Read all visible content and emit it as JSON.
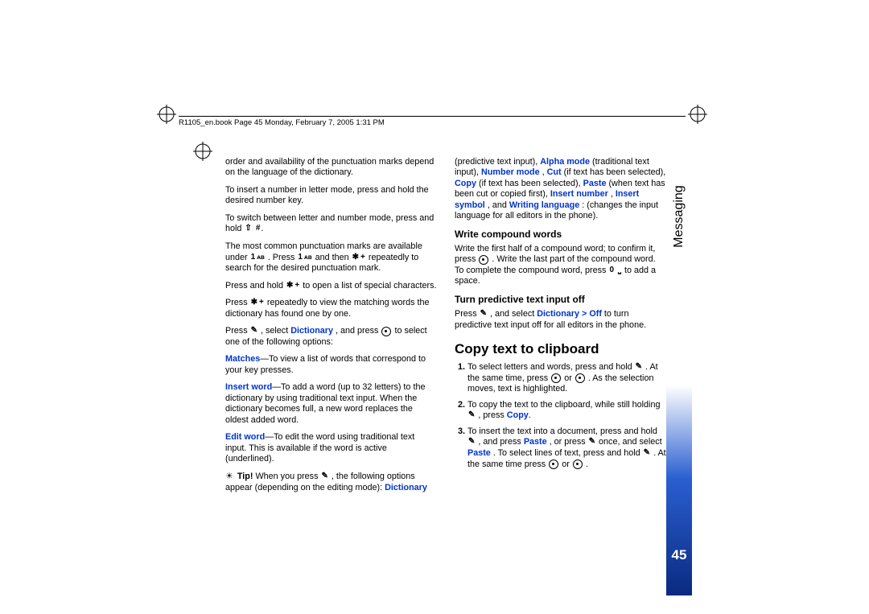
{
  "header": {
    "crop_info": "R1105_en.book  Page 45  Monday, February 7, 2005  1:31 PM"
  },
  "side": {
    "section": "Messaging",
    "page": "45"
  },
  "left_col": {
    "p1": "order and availability of the punctuation marks depend on the language of the dictionary.",
    "p2": "To insert a number in letter mode, press and hold the desired number key.",
    "p3": "To switch between letter and number mode, press and hold ",
    "p4a": "The most common punctuation marks are available under ",
    "p4b": ". Press ",
    "p4c": " and then ",
    "p4d": " repeatedly to search for the desired punctuation mark.",
    "p5a": "Press and hold ",
    "p5b": " to open a list of special characters.",
    "p6a": "Press ",
    "p6b": " repeatedly to view the matching words the dictionary has found one by one.",
    "p7a": "Press ",
    "p7b": ", select ",
    "p7c": "Dictionary",
    "p7d": ", and press ",
    "p7e": " to select one of the following options:",
    "p8a": "Matches",
    "p8b": "—To view a list of words that correspond to your key presses.",
    "p9a": "Insert word",
    "p9b": "—To add a word (up to 32 letters) to the dictionary by using traditional text input. When the dictionary becomes full, a new word replaces the oldest added word.",
    "p10a": "Edit word",
    "p10b": "—To edit the word using traditional text input. This is available if the word is active (underlined).",
    "tip_label": "Tip!",
    "tip_a": " When you press ",
    "tip_b": ", the following options appear (depending on the editing mode): ",
    "tip_c": "Dictionary"
  },
  "right_col": {
    "p1a": "(predictive text input), ",
    "p1b": "Alpha mode",
    "p1c": " (traditional text input), ",
    "p1d": "Number mode",
    "p1e": ", ",
    "p1f": "Cut",
    "p1g": " (if text has been selected), ",
    "p1h": "Copy",
    "p1i": " (if text has been selected), ",
    "p1j": "Paste",
    "p1k": " (when text has been cut or copied first), ",
    "p1l": "Insert number",
    "p1m": ", ",
    "p1n": "Insert symbol",
    "p1o": ", and ",
    "p1p": "Writing language",
    "p1q": ": (changes the input language for all editors in the phone).",
    "h_compound": "Write compound words",
    "p2a": "Write the first half of a compound word; to confirm it, press ",
    "p2b": ". Write the last part of the compound word. To complete the compound word, press ",
    "p2c": " to add a space.",
    "h_turnoff": "Turn predictive text input off",
    "p3a": "Press ",
    "p3b": ", and select ",
    "p3c": "Dictionary > Off",
    "p3d": " to turn predictive text input off for all editors in the phone.",
    "h_copy": "Copy text to clipboard",
    "s1a": "To select letters and words, press and hold ",
    "s1b": ". At the same time, press ",
    "s1c": " or ",
    "s1d": ". As the selection moves, text is highlighted.",
    "s2a": "To copy the text to the clipboard, while still holding ",
    "s2b": ", press ",
    "s2c": "Copy",
    "s2d": ".",
    "s3a": "To insert the text into a document, press and hold ",
    "s3b": ", and press ",
    "s3c": "Paste",
    "s3d": ", or press ",
    "s3e": " once, and select ",
    "s3f": "Paste",
    "s3g": ". To select lines of text, press and hold ",
    "s3h": ". At the same time press ",
    "s3i": " or ",
    "s3j": "."
  }
}
